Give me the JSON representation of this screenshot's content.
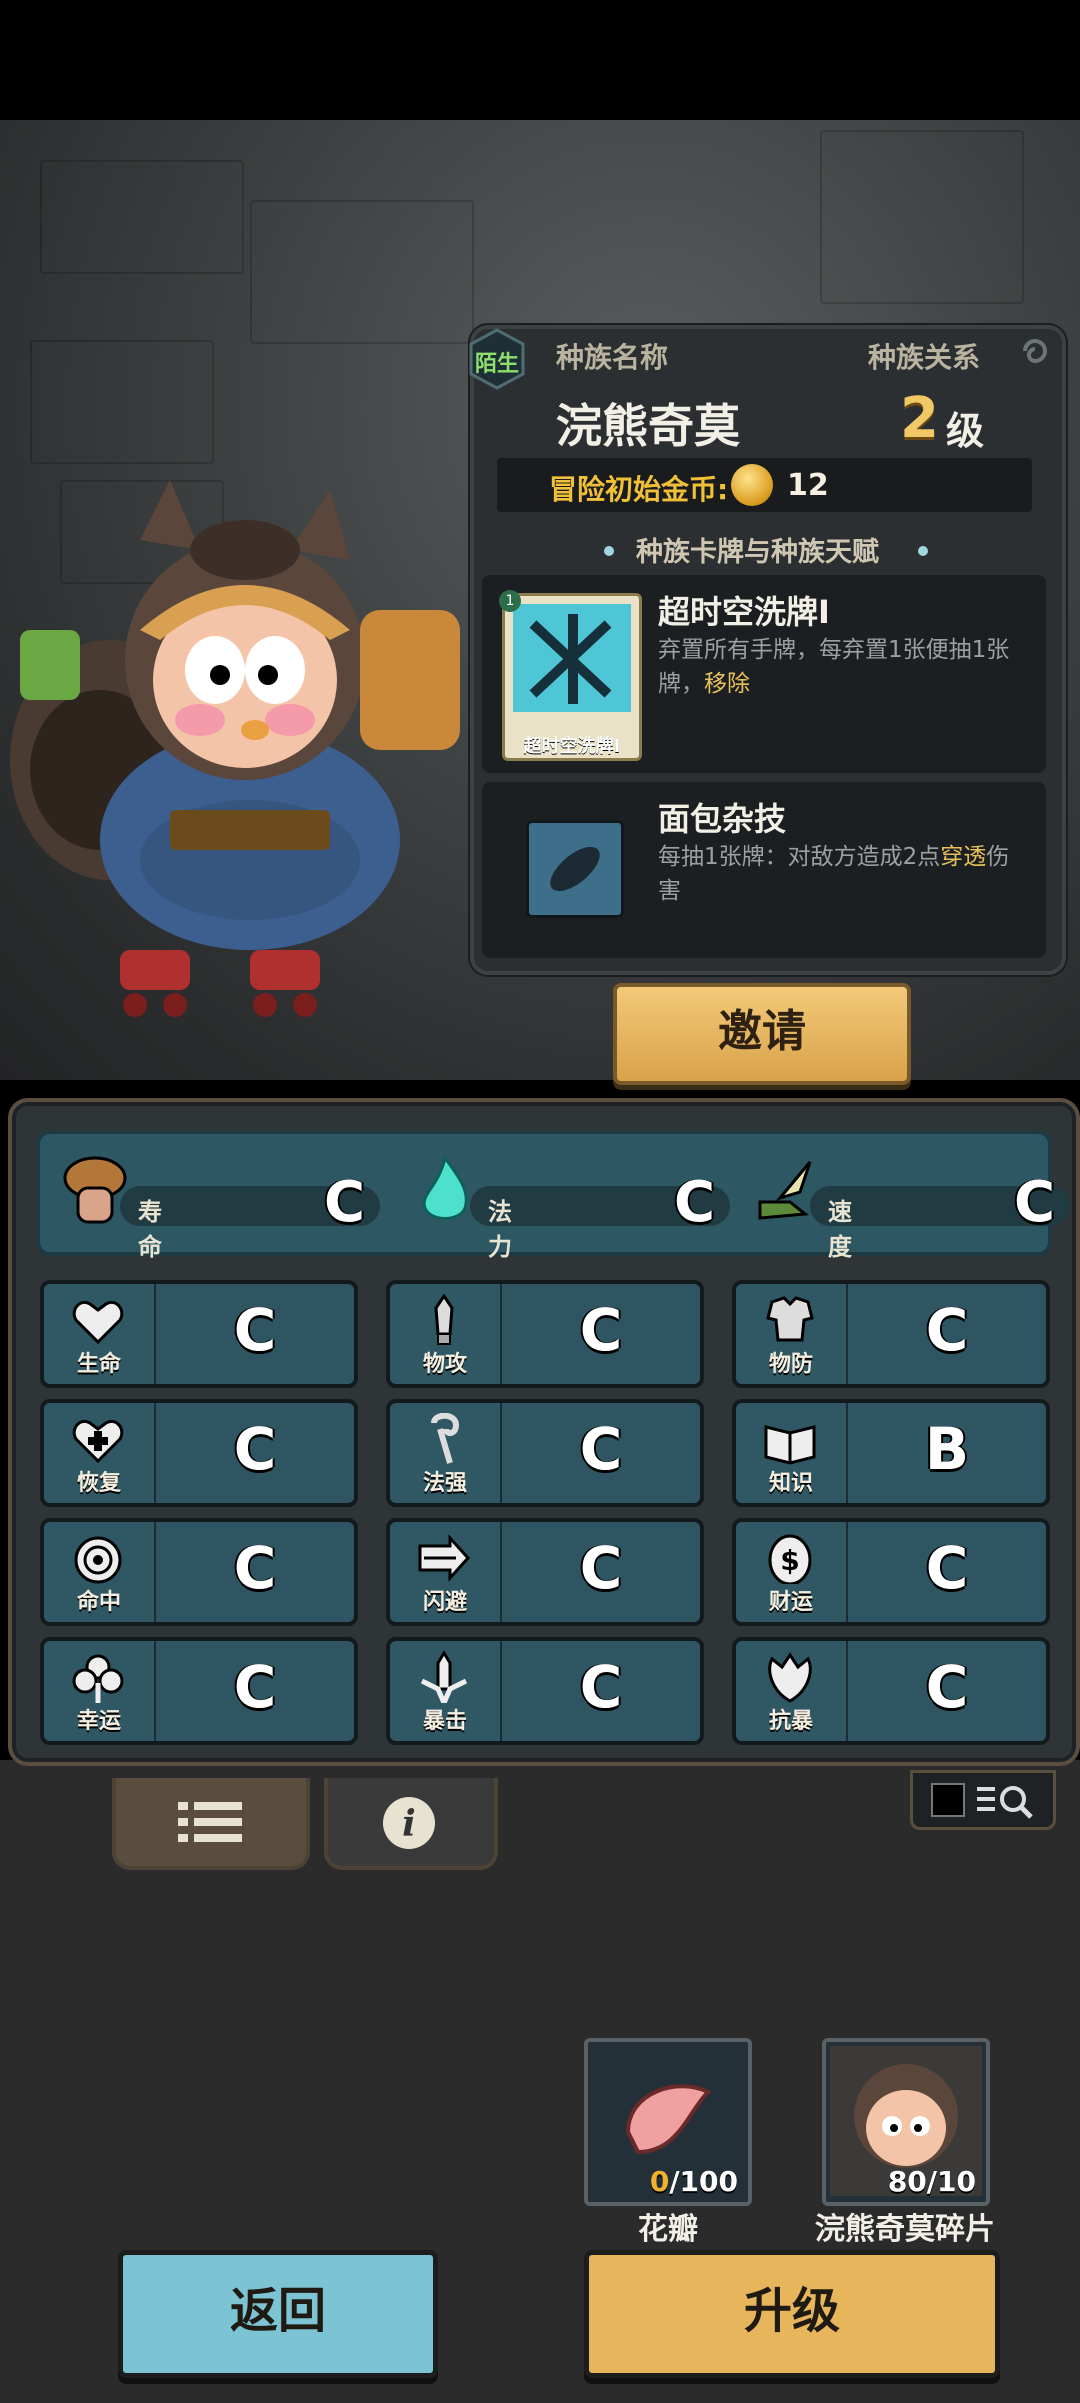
{
  "race": {
    "relation_badge": "陌生",
    "name_label": "种族名称",
    "relation_label": "种族关系",
    "name": "浣熊奇莫",
    "level": "2",
    "level_suffix": "级",
    "start_gold_label": "冒险初始金币:",
    "start_gold": "12",
    "section_title": "种族卡牌与种族天赋"
  },
  "cards": [
    {
      "title": "超时空洗牌I",
      "desc_before": "弃置所有手牌，每弃置1张便抽1张牌，",
      "desc_highlight": "移除",
      "desc_after": "",
      "image_caption": "超时空洗牌I",
      "badge": "1"
    },
    {
      "title": "面包杂技",
      "desc_before": "每抽1张牌：对敌方造成2点",
      "desc_highlight": "穿透",
      "desc_after": "伤害"
    }
  ],
  "invite_label": "邀请",
  "top_stats": [
    {
      "name": "寿命",
      "grade": "C",
      "icon": "mushroom-icon"
    },
    {
      "name": "法力",
      "grade": "C",
      "icon": "flame-icon"
    },
    {
      "name": "速度",
      "grade": "C",
      "icon": "wing-boot-icon"
    }
  ],
  "stats": [
    {
      "name": "生命",
      "grade": "C",
      "icon": "heart-icon"
    },
    {
      "name": "物攻",
      "grade": "C",
      "icon": "sword-icon"
    },
    {
      "name": "物防",
      "grade": "C",
      "icon": "armor-icon"
    },
    {
      "name": "恢复",
      "grade": "C",
      "icon": "heart-plus-icon"
    },
    {
      "name": "法强",
      "grade": "C",
      "icon": "staff-icon"
    },
    {
      "name": "知识",
      "grade": "B",
      "icon": "book-icon"
    },
    {
      "name": "命中",
      "grade": "C",
      "icon": "target-icon"
    },
    {
      "name": "闪避",
      "grade": "C",
      "icon": "dash-arrow-icon"
    },
    {
      "name": "财运",
      "grade": "C",
      "icon": "coin-icon"
    },
    {
      "name": "幸运",
      "grade": "C",
      "icon": "clover-icon"
    },
    {
      "name": "暴击",
      "grade": "C",
      "icon": "crit-sword-icon"
    },
    {
      "name": "抗暴",
      "grade": "C",
      "icon": "shield-flower-icon"
    }
  ],
  "materials": [
    {
      "name": "花瓣",
      "have": "0",
      "need": "/100",
      "icon": "petal-icon"
    },
    {
      "name": "浣熊奇莫碎片",
      "have": "80",
      "need": "/10",
      "icon": "raccoon-portrait-icon"
    }
  ],
  "back_label": "返回",
  "upgrade_label": "升级",
  "colors": {
    "accent_gold": "#f0c866",
    "panel_teal": "#2e5561",
    "back_button": "#7cc3d4",
    "upgrade_button": "#e6b55c"
  }
}
